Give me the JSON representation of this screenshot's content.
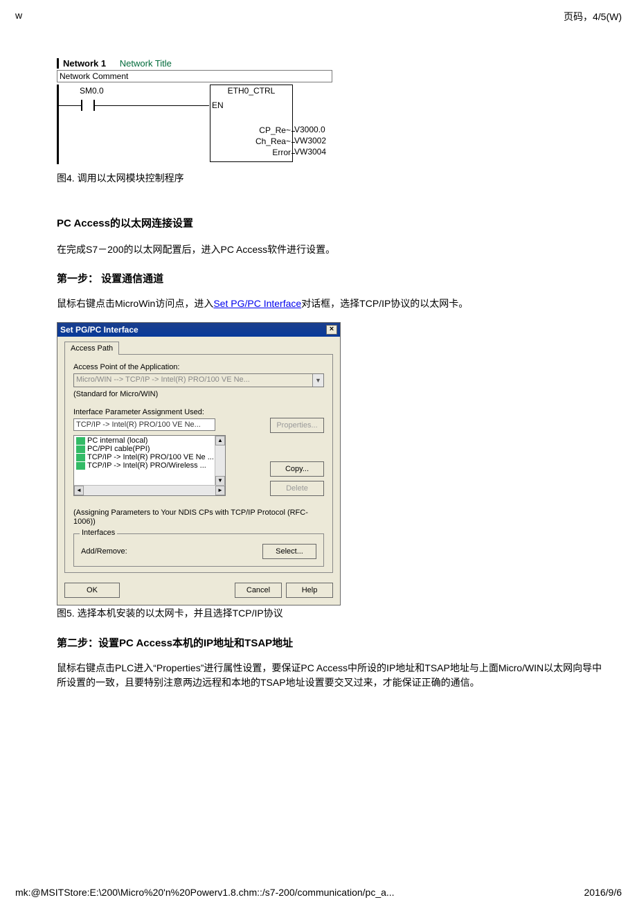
{
  "header": {
    "left": "w",
    "right": "页码，4/5(W)"
  },
  "network": {
    "label": "Network 1",
    "title": "Network Title",
    "comment": "Network Comment",
    "input_label": "SM0.0",
    "fb_title": "ETH0_CTRL",
    "en": "EN",
    "pins": [
      {
        "name": "CP_Re~",
        "ext": "V3000.0"
      },
      {
        "name": "Ch_Rea~",
        "ext": "VW3002"
      },
      {
        "name": "Error",
        "ext": "VW3004"
      }
    ]
  },
  "fig4_caption": "图4. 调用以太网模块控制程序",
  "section1_title": "PC Access的以太网连接设置",
  "para1": "在完成S7－200的以太网配置后，进入PC Access软件进行设置。",
  "step1_title": "第一步：  设置通信通道",
  "para2_a": "鼠标右键点击MicroWin访问点，进入",
  "para2_link": "Set PG/PC Interface",
  "para2_b": "对话框，选择TCP/IP协议的以太网卡。",
  "dialog": {
    "title": "Set PG/PC Interface",
    "tab": "Access Path",
    "access_point_label": "Access Point of the Application:",
    "access_point_value": "Micro/WIN     --> TCP/IP -> Intel(R) PRO/100 VE Ne...",
    "standard": "(Standard for Micro/WIN)",
    "interface_label": "Interface Parameter Assignment Used:",
    "interface_value": "TCP/IP -> Intel(R) PRO/100 VE Ne...",
    "btn_properties": "Properties...",
    "list": {
      "i0": "PC internal (local)",
      "i1": "PC/PPI cable(PPI)",
      "i2": "TCP/IP -> Intel(R) PRO/100 VE Ne ...",
      "i3": "TCP/IP -> Intel(R) PRO/Wireless ..."
    },
    "btn_copy": "Copy...",
    "btn_delete": "Delete",
    "note": "(Assigning Parameters to Your NDIS CPs with TCP/IP Protocol (RFC-1006))",
    "group_legend": "Interfaces",
    "addremove": "Add/Remove:",
    "btn_select": "Select...",
    "btn_ok": "OK",
    "btn_cancel": "Cancel",
    "btn_help": "Help"
  },
  "fig5_caption": "图5. 选择本机安装的以太网卡，并且选择TCP/IP协议",
  "step2_title": "第二步：设置PC Access本机的IP地址和TSAP地址",
  "para3": "鼠标右键点击PLC进入“Properties”进行属性设置，要保证PC Access中所设的IP地址和TSAP地址与上面Micro/WIN以太网向导中所设置的一致，且要特别注意两边远程和本地的TSAP地址设置要交叉过来，才能保证正确的通信。",
  "footer": {
    "path": "mk:@MSITStore:E:\\200\\Micro%20'n%20Powerv1.8.chm::/s7-200/communication/pc_a...",
    "date": "2016/9/6"
  }
}
